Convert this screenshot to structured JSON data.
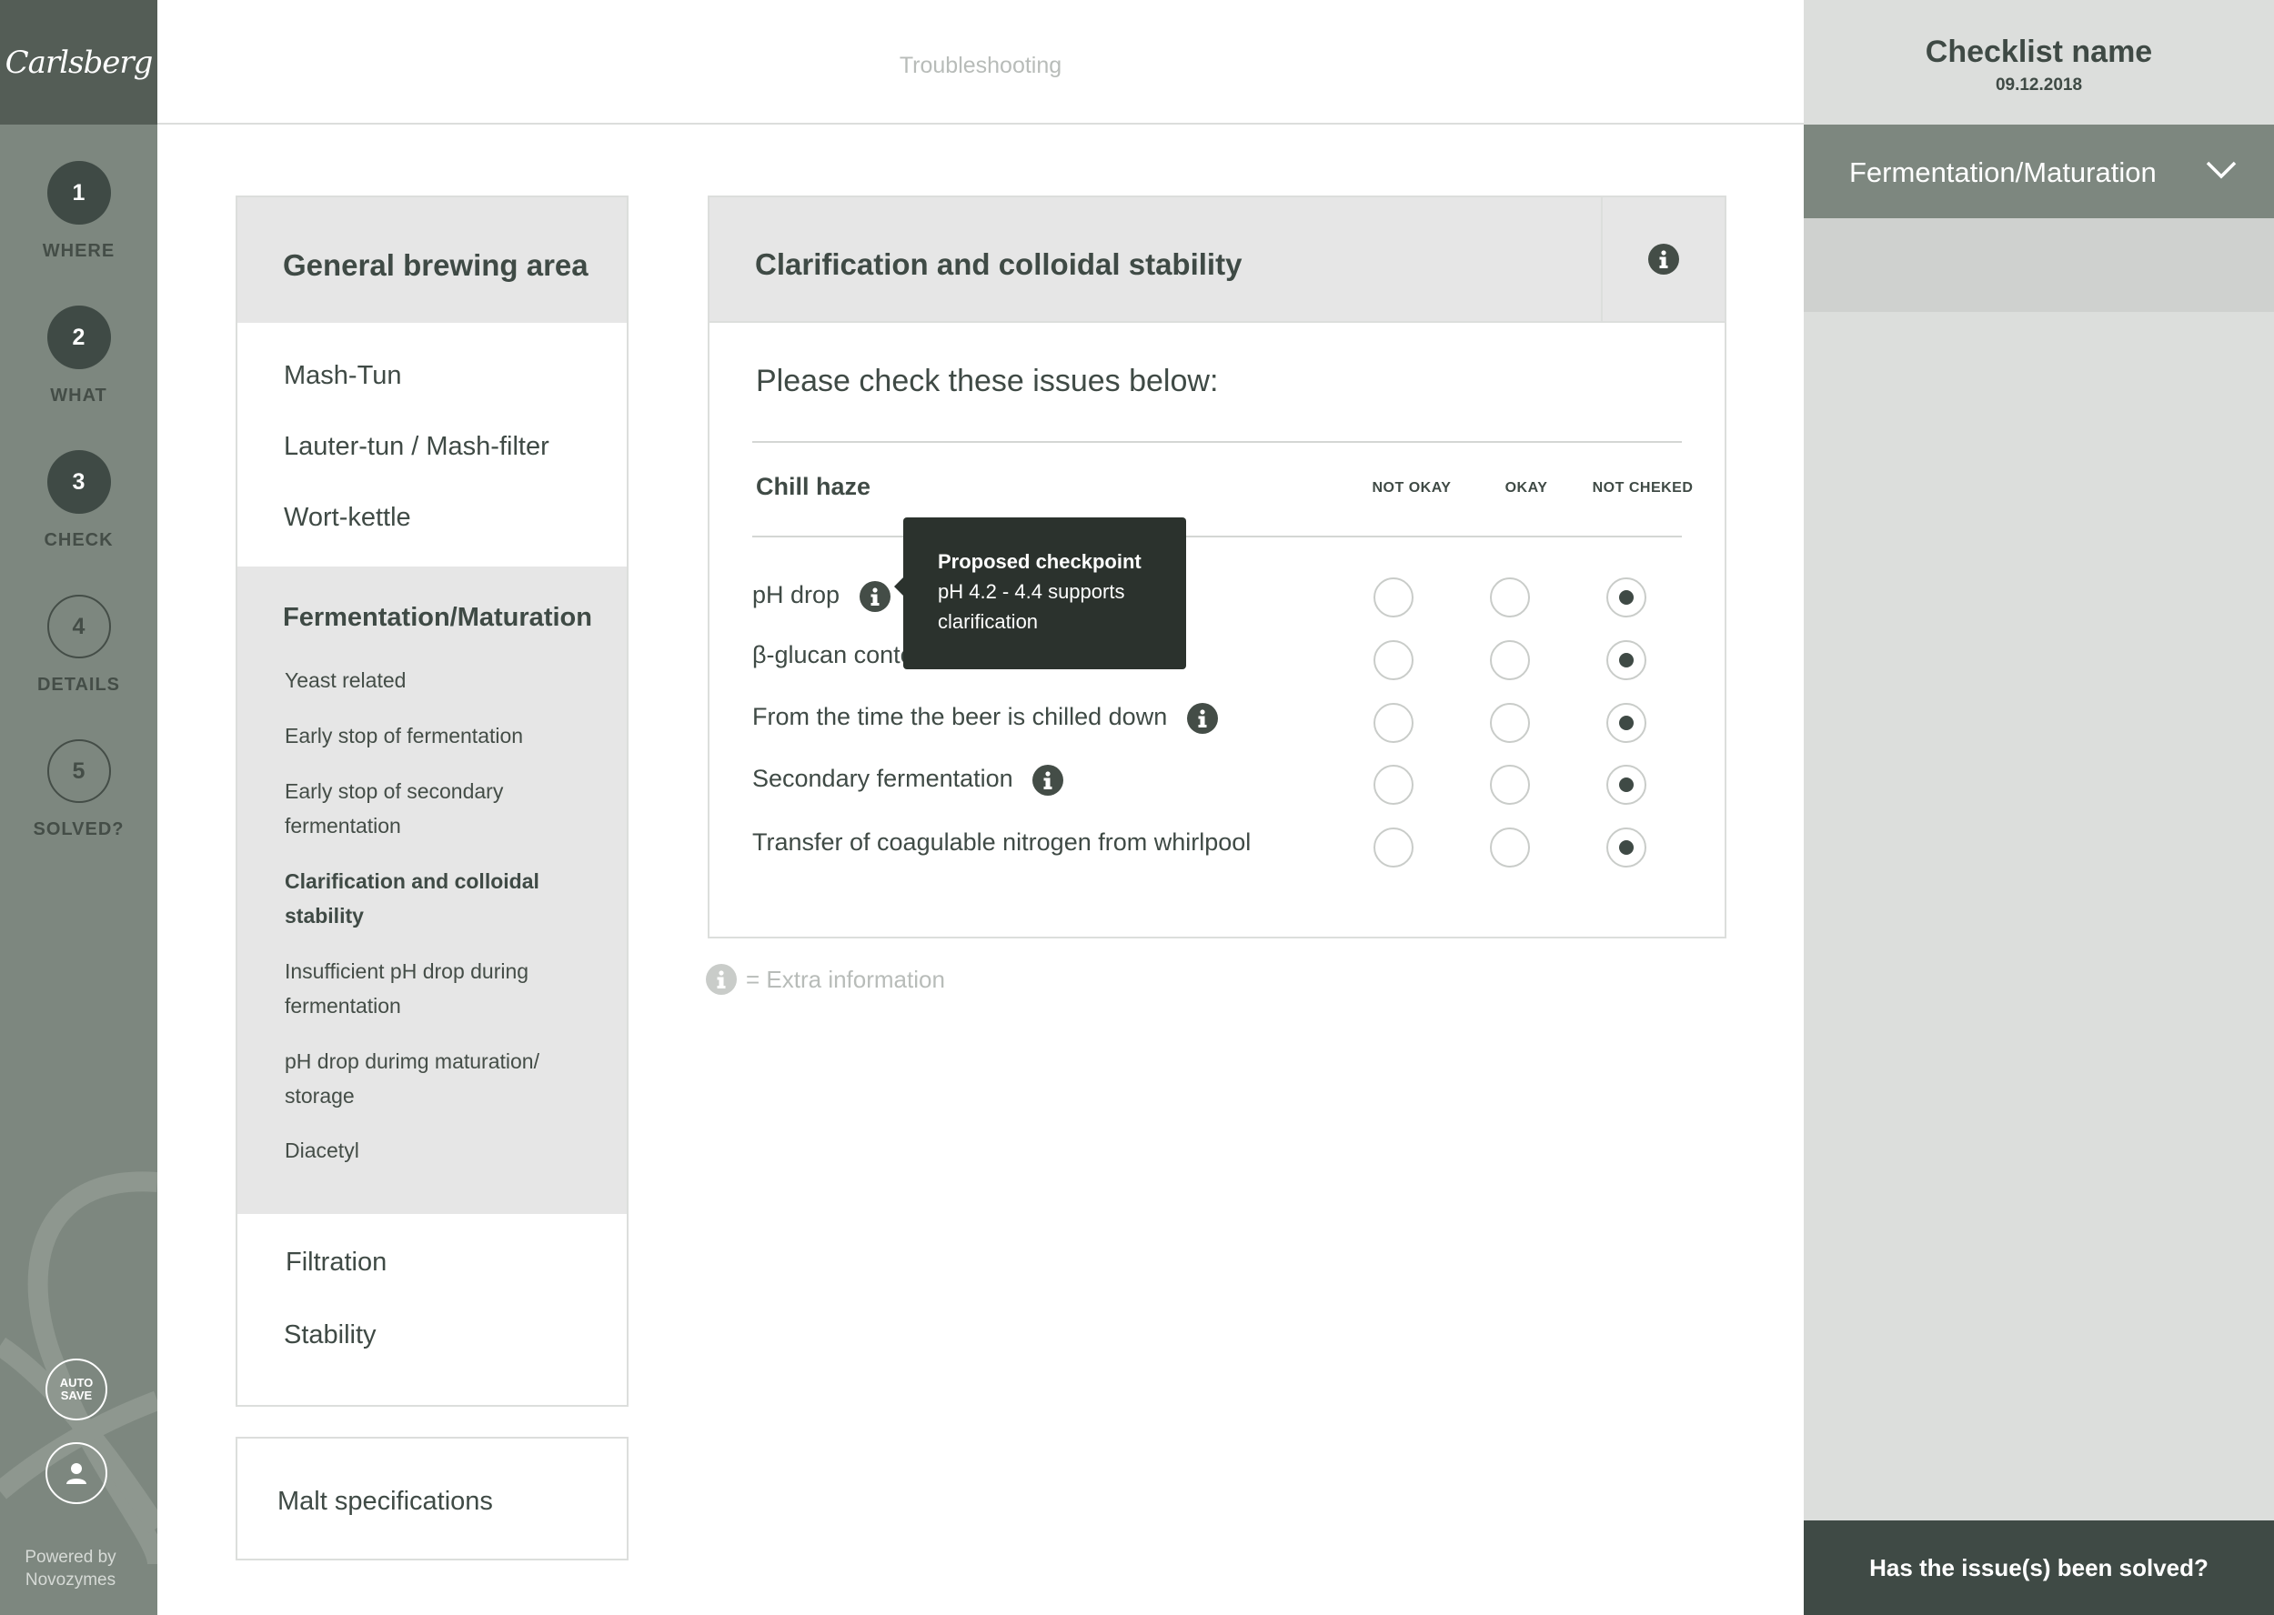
{
  "brand": {
    "logo_text": "Carlsberg",
    "powered_by": "Powered by Novozymes"
  },
  "steps": [
    {
      "number": "1",
      "label": "WHERE",
      "state": "completed"
    },
    {
      "number": "2",
      "label": "WHAT",
      "state": "completed"
    },
    {
      "number": "3",
      "label": "CHECK",
      "state": "current"
    },
    {
      "number": "4",
      "label": "DETAILS",
      "state": "pending"
    },
    {
      "number": "5",
      "label": "SOLVED?",
      "state": "pending"
    }
  ],
  "rail_buttons": {
    "autosave_line1": "AUTO",
    "autosave_line2": "SAVE",
    "profile_icon": "user-icon"
  },
  "header": {
    "title": "Troubleshooting"
  },
  "categories": {
    "header": "General brewing area",
    "items_before": [
      "Mash-Tun",
      "Lauter-tun / Mash-filter",
      "Wort-kettle"
    ],
    "expanded": {
      "title": "Fermentation/Maturation",
      "sub_items": [
        "Yeast related",
        "Early stop of fermentation",
        "Early stop of secondary fermentation",
        "Clarification and colloidal stability",
        "Insufficient pH drop during fermentation",
        "pH drop durimg maturation/ storage",
        "Diacetyl"
      ],
      "selected": "Clarification and colloidal stability"
    },
    "items_after": [
      "Filtration",
      "Stability"
    ],
    "extra": "Malt specifications"
  },
  "card": {
    "title": "Clarification and colloidal stability",
    "instruction": "Please check these issues below:",
    "issue": "Chill haze",
    "columns": [
      "NOT OKAY",
      "OKAY",
      "NOT CHEKED"
    ],
    "rows": [
      {
        "label": "pH drop",
        "info": true,
        "value": "NOT CHEKED"
      },
      {
        "label": "β-glucan content",
        "info": false,
        "value": "NOT CHEKED"
      },
      {
        "label": "From the time the beer is chilled down",
        "info": true,
        "value": "NOT CHEKED"
      },
      {
        "label": "Secondary fermentation",
        "info": true,
        "value": "NOT CHEKED"
      },
      {
        "label": "Transfer of coagulable nitrogen from whirlpool",
        "info": false,
        "value": "NOT CHEKED"
      }
    ]
  },
  "tooltip": {
    "title": "Proposed checkpoint",
    "body": "pH 4.2 - 4.4 supports clarification"
  },
  "legend": {
    "text": "= Extra information"
  },
  "right_panel": {
    "checklist_name": "Checklist name",
    "date": "09.12.2018",
    "dropdown_value": "Fermentation/Maturation",
    "solved_question": "Has the issue(s) been solved?"
  },
  "colors": {
    "rail": "#7d877f",
    "rail_dark": "#545d56",
    "accent_dark": "#3f4a45",
    "panel_bg": "#dcdedc",
    "header_bg": "#e6e6e6",
    "tooltip_bg": "#2b322d"
  }
}
